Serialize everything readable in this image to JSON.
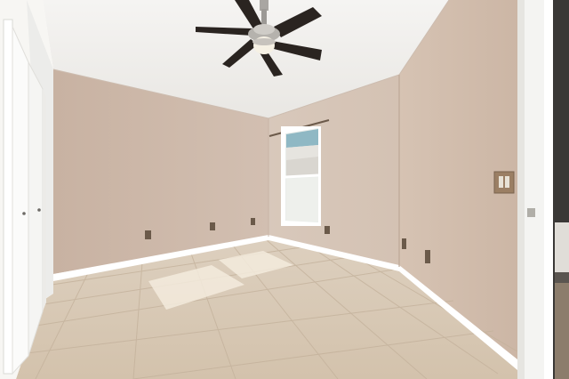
{
  "scene": {
    "description_kind": "photo",
    "room": "empty bedroom",
    "wall_color": "#cbb7a7",
    "ceiling_color": "#f3f2ef",
    "floor_color": "#d9c9b4",
    "trim_color": "#ffffff"
  },
  "objects": [
    "ceiling-fan",
    "window",
    "closet-bifold-door",
    "doorway-frame",
    "light-switch",
    "electrical-outlets",
    "tile-floor",
    "baseboards"
  ],
  "watermark": "",
  "colors": {
    "fan_blade": "#2a2420",
    "fan_metal": "#a9a6a2",
    "fan_light": "#f6f1e4",
    "window_glass": "#e8ece9",
    "window_sky": "#8fb7c3",
    "switch_plate": "#9b7f64"
  }
}
